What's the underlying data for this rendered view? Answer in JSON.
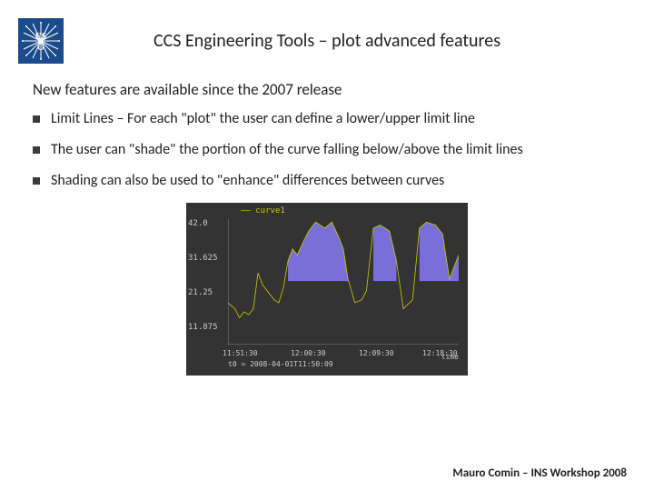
{
  "header": {
    "logo_alt": "ESO",
    "title": "CCS Engineering Tools – plot advanced features"
  },
  "subtitle": "New features are available since the 2007 release",
  "bullets": [
    "Limit Lines – For each \"plot\" the user can define a lower/upper limit line",
    "The user can \"shade\" the portion of the curve falling below/above the limit lines",
    "Shading can also be used to \"enhance\" differences between curves"
  ],
  "chart_data": {
    "type": "area",
    "legend": "curve1",
    "yticks": [
      "42.0",
      "31.625",
      "21.25",
      "11.875"
    ],
    "ylim": [
      0,
      42
    ],
    "xticks": [
      "11:51:30",
      "12:00:30",
      "12:09:30",
      "12:18:30"
    ],
    "xlabel": "time",
    "x_subtitle": "t0 = 2008-04-01T11:50:09",
    "limit": 21.25,
    "series": [
      {
        "name": "curve1",
        "x": [
          0,
          3,
          5,
          7,
          9,
          11,
          13,
          15,
          18,
          20,
          22,
          24,
          26,
          28,
          30,
          33,
          35,
          38,
          40,
          42,
          45,
          48,
          50,
          52,
          55,
          58,
          60,
          63,
          66,
          70,
          73,
          76,
          80,
          83,
          86,
          90,
          93,
          96,
          100
        ],
        "y": [
          14,
          12,
          9,
          11,
          10,
          12,
          24,
          20,
          17,
          15,
          14,
          19,
          28,
          32,
          30,
          35,
          38,
          41,
          40,
          39,
          41,
          36,
          32,
          22,
          14,
          15,
          18,
          39,
          40,
          38,
          28,
          12,
          15,
          39,
          41,
          40,
          37,
          22,
          30
        ]
      }
    ]
  },
  "footer": "Mauro Comin – INS Workshop 2008"
}
